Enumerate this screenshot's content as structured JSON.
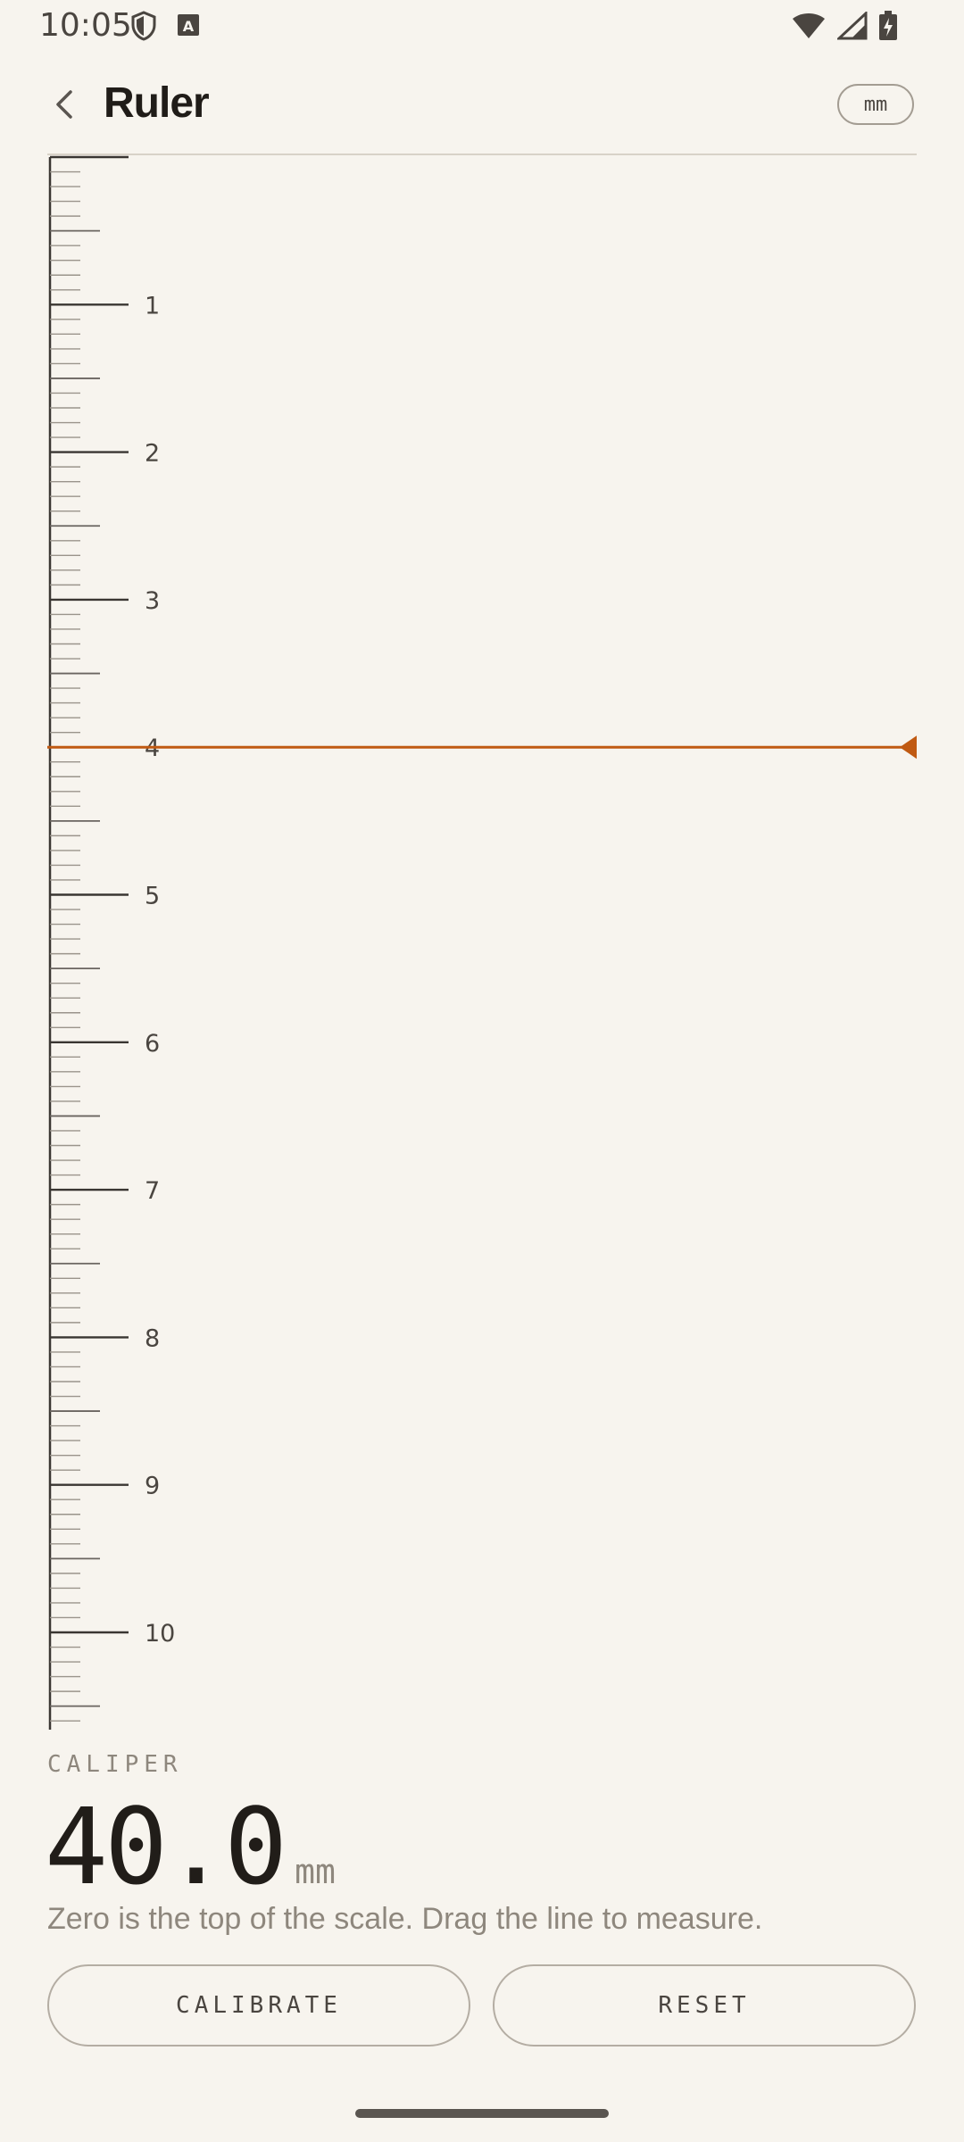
{
  "status_bar": {
    "time": "10:05",
    "left_icons": [
      "shield-icon",
      "keyboard-a-icon"
    ],
    "right_icons": [
      "wifi-icon",
      "cell-signal-icon",
      "battery-charging-icon"
    ]
  },
  "header": {
    "title": "Ruler",
    "back_icon": "chevron-left-icon",
    "unit_chip": "mm"
  },
  "ruler": {
    "unit": "cm",
    "labels": [
      "1",
      "2",
      "3",
      "4",
      "5",
      "6",
      "7",
      "8",
      "9",
      "10"
    ],
    "marker_value_mm": 40.0,
    "colors": {
      "marker": "#c05a12",
      "ticks": "#3a3632"
    }
  },
  "caliper": {
    "label": "CALIPER",
    "value": "40.0",
    "unit": "mm",
    "hint": "Zero is the top of the scale. Drag the line to measure."
  },
  "buttons": {
    "calibrate": "CALIBRATE",
    "reset": "RESET"
  }
}
